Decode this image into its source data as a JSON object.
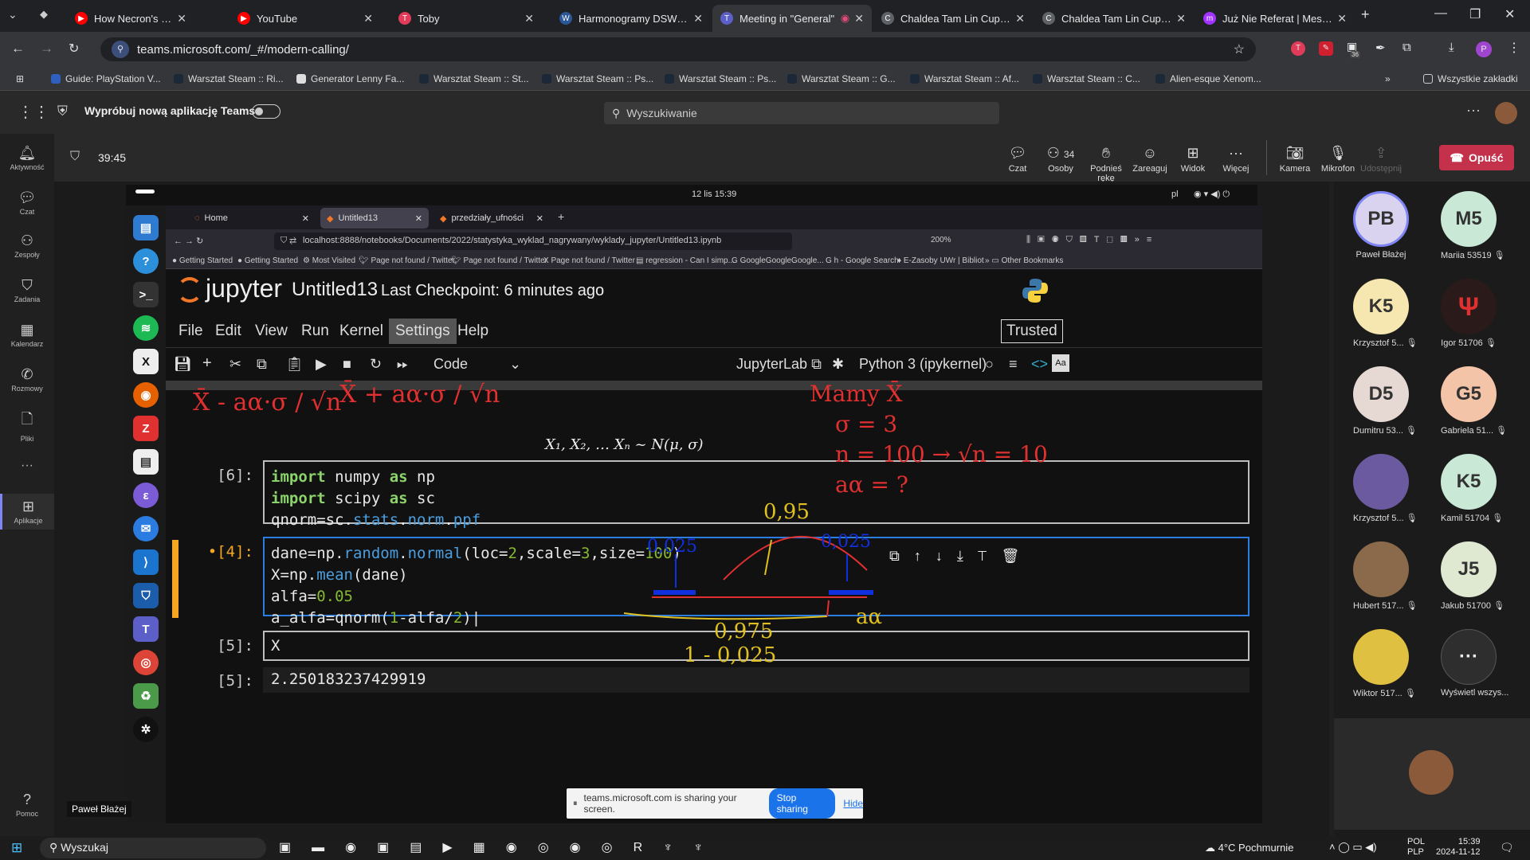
{
  "browser": {
    "tabs": [
      {
        "title": "How Necron's Stilling Af",
        "color": "#ff0000"
      },
      {
        "title": "YouTube",
        "color": "#ff0000"
      },
      {
        "title": "Toby",
        "color": "#e03c5a"
      },
      {
        "title": "Harmonogramy DSW - P",
        "color": "#2b5797"
      },
      {
        "title": "Meeting in \"General\"",
        "color": "#5b5fc7"
      },
      {
        "title": "Chaldea Tam Lin Cup - W",
        "color": "#5f6368"
      },
      {
        "title": "Chaldea Tam Lin Cup - B",
        "color": "#5f6368"
      },
      {
        "title": "Już Nie Referat | Messen",
        "color": "#a033ff"
      }
    ],
    "url": "teams.microsoft.com/_#/modern-calling/",
    "bookmarks": [
      "Guide: PlayStation V...",
      "Warsztat Steam :: Ri...",
      "Generator Lenny Fa...",
      "Warsztat Steam :: St...",
      "Warsztat Steam :: Ps...",
      "Warsztat Steam :: Ps...",
      "Warsztat Steam :: G...",
      "Warsztat Steam :: Af...",
      "Warsztat Steam :: C...",
      "Alien-esque Xenom..."
    ],
    "all_bookmarks": "Wszystkie zakładki",
    "ext_badge": "36"
  },
  "teams": {
    "try_new": "Wypróbuj nową aplikację Teams",
    "search_placeholder": "Wyszukiwanie",
    "rail": [
      "Aktywność",
      "Czat",
      "Zespoły",
      "Zadania",
      "Kalendarz",
      "Rozmowy",
      "Pliki",
      "Aplikacje",
      "Pomoc"
    ],
    "timer": "39:45",
    "controls": {
      "chat": "Czat",
      "people": "Osoby",
      "people_count": "34",
      "raise": "Podnieś rękę",
      "react": "Zareaguj",
      "view": "Widok",
      "more": "Więcej",
      "camera": "Kamera",
      "mic": "Mikrofon",
      "share": "Udostępnij",
      "leave": "Opuść"
    },
    "presenter_name": "Paweł Błażej",
    "participants": [
      {
        "initials": "PB",
        "name": "Paweł Błażej",
        "color": "#d9d3f0"
      },
      {
        "initials": "M5",
        "name": "Mariia 53519",
        "color": "#c9e8d6"
      },
      {
        "initials": "K5",
        "name": "Krzysztof 5...",
        "color": "#f6e6b0"
      },
      {
        "initials": "",
        "name": "Igor 51706",
        "color": "#2a1a1a"
      },
      {
        "initials": "D5",
        "name": "Dumitru 53...",
        "color": "#e6d9d4"
      },
      {
        "initials": "G5",
        "name": "Gabriela 51...",
        "color": "#f3c4a8"
      },
      {
        "initials": "",
        "name": "Krzysztof 5...",
        "color": "#6c5aa0"
      },
      {
        "initials": "K5",
        "name": "Kamil 51704",
        "color": "#c9e8d6"
      },
      {
        "initials": "",
        "name": "Hubert 517...",
        "color": "#8a6a4a"
      },
      {
        "initials": "J5",
        "name": "Jakub 51700",
        "color": "#dfe8d0"
      },
      {
        "initials": "",
        "name": "Wiktor 517...",
        "color": "#e0c040"
      },
      {
        "initials": "···",
        "name": "Wyświetl wszys...",
        "color": "#2e2e2e"
      }
    ],
    "sharing_text": "teams.microsoft.com is sharing your screen.",
    "stop_sharing": "Stop sharing",
    "hide": "Hide"
  },
  "shared": {
    "clock": "12 lis  15:39",
    "lang": "pl",
    "ff_tabs": [
      "Home",
      "Untitled13",
      "przedziały_ufności"
    ],
    "ff_url": "localhost:8888/notebooks/Documents/2022/statystyka_wyklad_nagrywany/wyklady_jupyter/Untitled13.ipynb",
    "ff_zoom": "200%",
    "ff_bookmarks": [
      "Getting Started",
      "Getting Started",
      "Most Visited",
      "Page not found / Twitter",
      "Page not found / Twitter",
      "Page not found / Twitter",
      "regression - Can I simp...",
      "GoogleGoogleGoogle...",
      "h - Google Search",
      "E-Zasoby UWr | Bibliot",
      "Other Bookmarks"
    ],
    "jupyter": {
      "logo": "jupyter",
      "notebook": "Untitled13",
      "checkpoint": "Last Checkpoint: 6 minutes ago",
      "menu": [
        "File",
        "Edit",
        "View",
        "Run",
        "Kernel",
        "Settings",
        "Help"
      ],
      "trusted": "Trusted",
      "cell_type": "Code",
      "jupyterlab": "JupyterLab",
      "kernel": "Python 3 (ipykernel)",
      "formula": "X₁, X₂, … Xₙ ~ N(μ, σ)",
      "cells": [
        {
          "prompt": "[6]:"
        },
        {
          "prompt": "•[4]:"
        },
        {
          "prompt": "[5]:",
          "code": "X"
        },
        {
          "prompt": "[5]:",
          "output": "2.250183237429919"
        }
      ],
      "annotations": {
        "left1": "X̄ - aα·σ / √n",
        "left2": "X̄ + aα·σ / √n",
        "right1": "Mamy X̄",
        "right2": "σ = 3",
        "right3": "n = 100 → √n = 10",
        "right4": "aα = ?",
        "p95": "0,95",
        "p025a": "0,025",
        "p025b": "0,025",
        "p975": "0,975",
        "minus": "1 - 0,025",
        "aalpha": "aα"
      }
    }
  },
  "taskbar": {
    "search": "Wyszukaj",
    "weather": "4°C  Pochmurnie",
    "lang1": "POL",
    "lang2": "PLP",
    "time": "15:39",
    "date": "2024-11-12"
  }
}
